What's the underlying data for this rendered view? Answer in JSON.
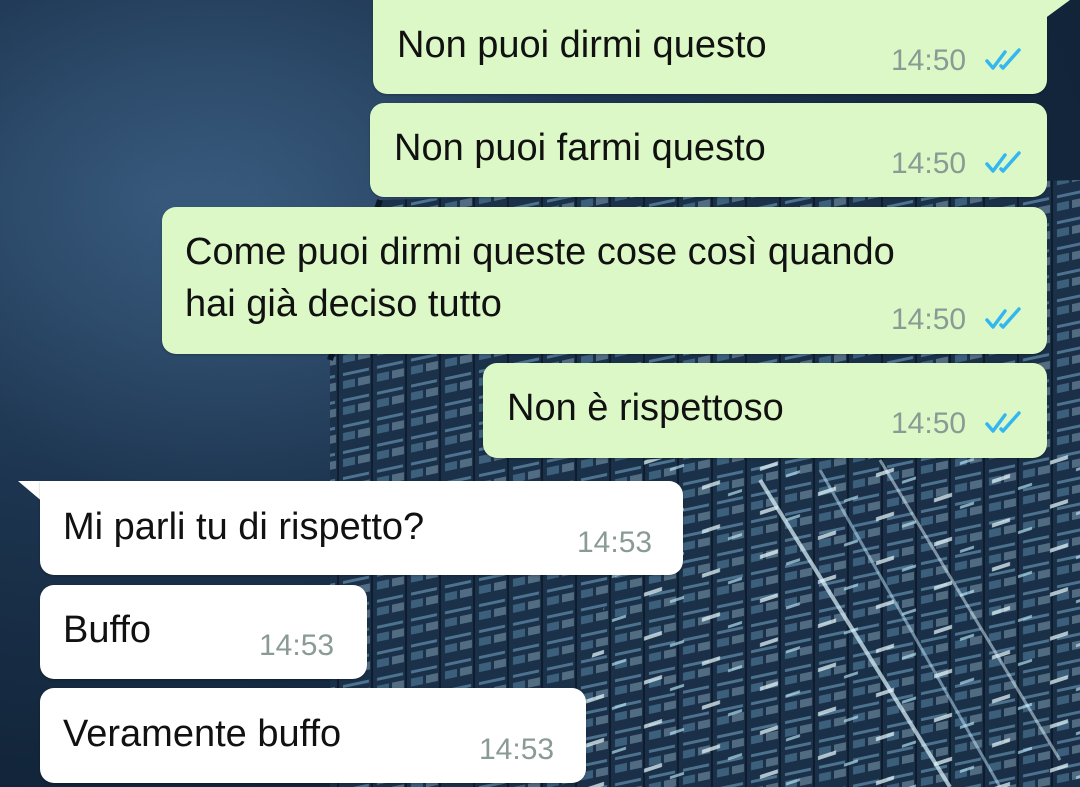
{
  "conversation": {
    "messages": [
      {
        "direction": "outgoing",
        "text": "Non puoi dirmi questo",
        "time": "14:50",
        "status": "read"
      },
      {
        "direction": "outgoing",
        "text": "Non puoi farmi questo",
        "time": "14:50",
        "status": "read"
      },
      {
        "direction": "outgoing",
        "text_line1": "Come puoi dirmi queste cose così quando",
        "text_line2": "hai già deciso tutto",
        "time": "14:50",
        "status": "read"
      },
      {
        "direction": "outgoing",
        "text": "Non è rispettoso",
        "time": "14:50",
        "status": "read"
      },
      {
        "direction": "incoming",
        "text": "Mi parli tu di rispetto?",
        "time": "14:53"
      },
      {
        "direction": "incoming",
        "text": "Buffo",
        "time": "14:53"
      },
      {
        "direction": "incoming",
        "text": "Veramente buffo",
        "time": "14:53"
      }
    ]
  },
  "colors": {
    "outgoing_bubble": "#dcf8c6",
    "incoming_bubble": "#ffffff",
    "read_ticks": "#34b7f1",
    "timestamp": "#8a9a94"
  },
  "icons": {
    "read_receipt": "double-check-icon"
  }
}
